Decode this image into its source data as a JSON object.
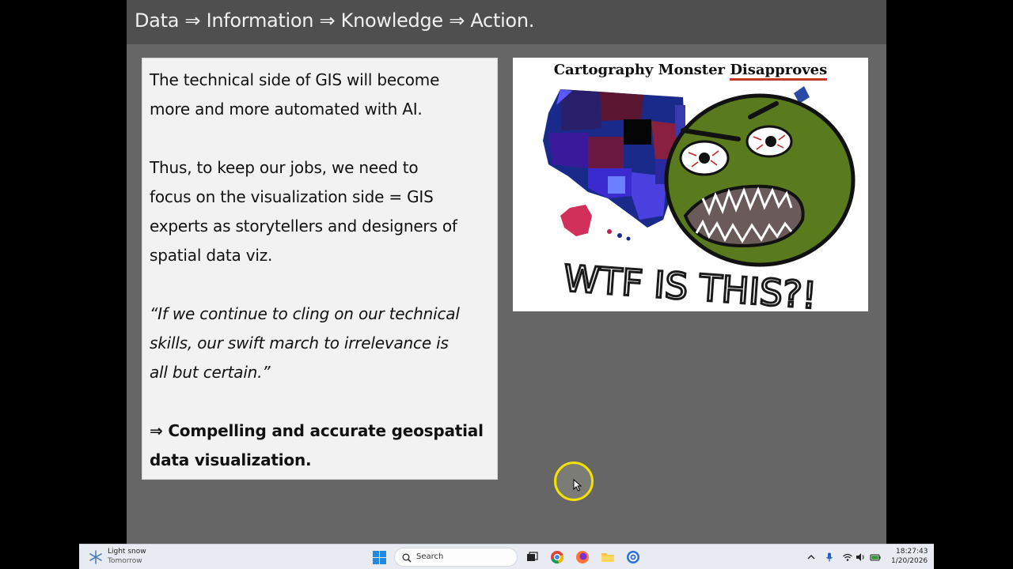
{
  "slide": {
    "title": "Data ⇒ Information ⇒ Knowledge ⇒ Action.",
    "text_box": {
      "p1_line1": "The technical side of GIS will become",
      "p1_line2": "more and more automated with AI.",
      "p2_line1": "Thus, to keep our jobs, we need to",
      "p2_line2": "focus on the visualization side = GIS",
      "p2_line3": "experts as storytellers and designers of",
      "p2_line4": "spatial data viz.",
      "quote_line1": "“If we continue to cling on our technical",
      "quote_line2": "skills, our swift march to irrelevance is",
      "quote_line3": "all but certain.”",
      "conclusion_line1": "⇒ Compelling and accurate geospatial",
      "conclusion_line2": "data visualization."
    },
    "meme": {
      "caption_part1": "Cartography Monster ",
      "caption_part2": "Disapproves",
      "exclamation": "WTF IS THIS?!"
    }
  },
  "taskbar": {
    "weather_condition": "Light snow",
    "weather_when": "Tomorrow",
    "search_label": "Search",
    "apps": [
      "taskview-icon",
      "chrome-icon",
      "firefox-icon",
      "file-explorer-icon",
      "active-app-icon"
    ],
    "time": "18:27:43",
    "date": "1/20/2026"
  },
  "colors": {
    "slide_bg": "#666666",
    "header_bg": "#4f4f4f",
    "text_box_bg": "#f2f2f2",
    "cursor_highlight": "#f2e200",
    "monster_green": "#5a7a1e"
  }
}
